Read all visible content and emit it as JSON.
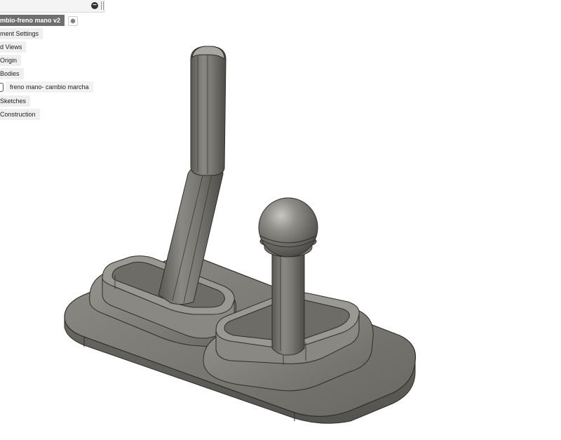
{
  "browser": {
    "root_label": "mbio-freno mano v2",
    "items": [
      {
        "label": "ment Settings"
      },
      {
        "label": "d Views"
      },
      {
        "label": "Origin"
      },
      {
        "label": "Bodies"
      },
      {
        "label": "freno mano- cambio marcha"
      },
      {
        "label": "Sketches"
      },
      {
        "label": "Construction"
      }
    ]
  },
  "icons": {
    "collapse": "minus-circle-icon",
    "activate": "radio-target-icon",
    "visibility": "visibility-icon"
  },
  "colors": {
    "model_body": "#7e7c76",
    "model_edge": "#2f2e2c",
    "root_bg": "#6f6f6f"
  }
}
